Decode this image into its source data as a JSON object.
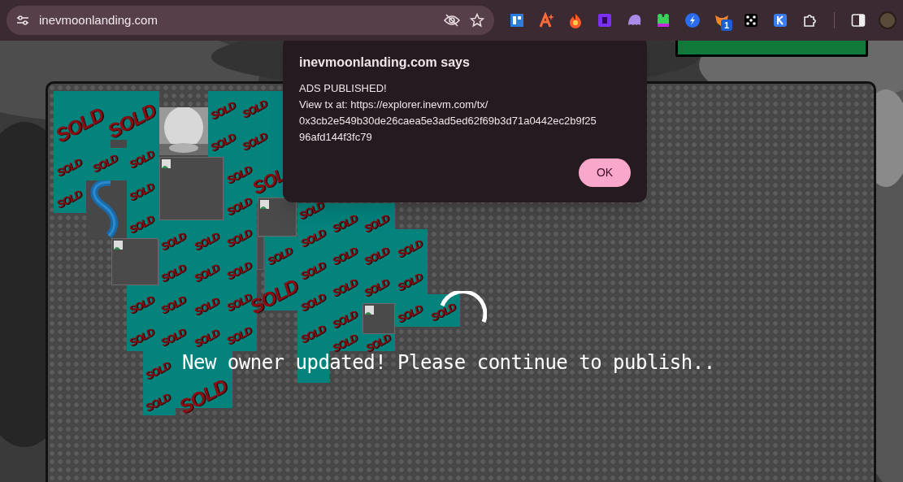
{
  "browser": {
    "url": "inevmoonlanding.com",
    "extension_badge": "1"
  },
  "canvas": {
    "sold_labels": [
      "SOLD",
      "SOLD",
      "SOLD",
      "SOLD",
      "SOLD",
      "SOLD",
      "SOLD",
      "SOLD",
      "SOLD",
      "SOLD",
      "SOLD",
      "SOLD",
      "SOLD",
      "SOL",
      "SOLD",
      "SOLD",
      "SOLD",
      "SOLD",
      "SOLD",
      "SOLD",
      "SOLD",
      "SOLD",
      "SOLD",
      "SOLD",
      "SOLD",
      "SOLD",
      "SOLD",
      "SOLD",
      "SOLD",
      "SOLD",
      "SOLD",
      "SOLD",
      "SOLD",
      "SOLD",
      "SOLD",
      "SOLD",
      "SOLD",
      "SOLD",
      "SOLD",
      "SOLD",
      "SOLD",
      "SOLD",
      "SOLD",
      "SOLD",
      "SOLD",
      "SOLD",
      "SOLD",
      "SOLD",
      "SOLD",
      "SOLD",
      "SOLD",
      "SOLD"
    ],
    "status": "New owner updated! Please continue to publish.."
  },
  "dialog": {
    "title": "inevmoonlanding.com says",
    "lines": [
      "ADS PUBLISHED!",
      "View tx at: https://explorer.inevm.com/tx/",
      "0x3cb2e549b30de26caea5e3ad5ed62f69b3d71a0442ec2b9f25",
      "96afd144f3fc79"
    ],
    "button": "OK"
  }
}
